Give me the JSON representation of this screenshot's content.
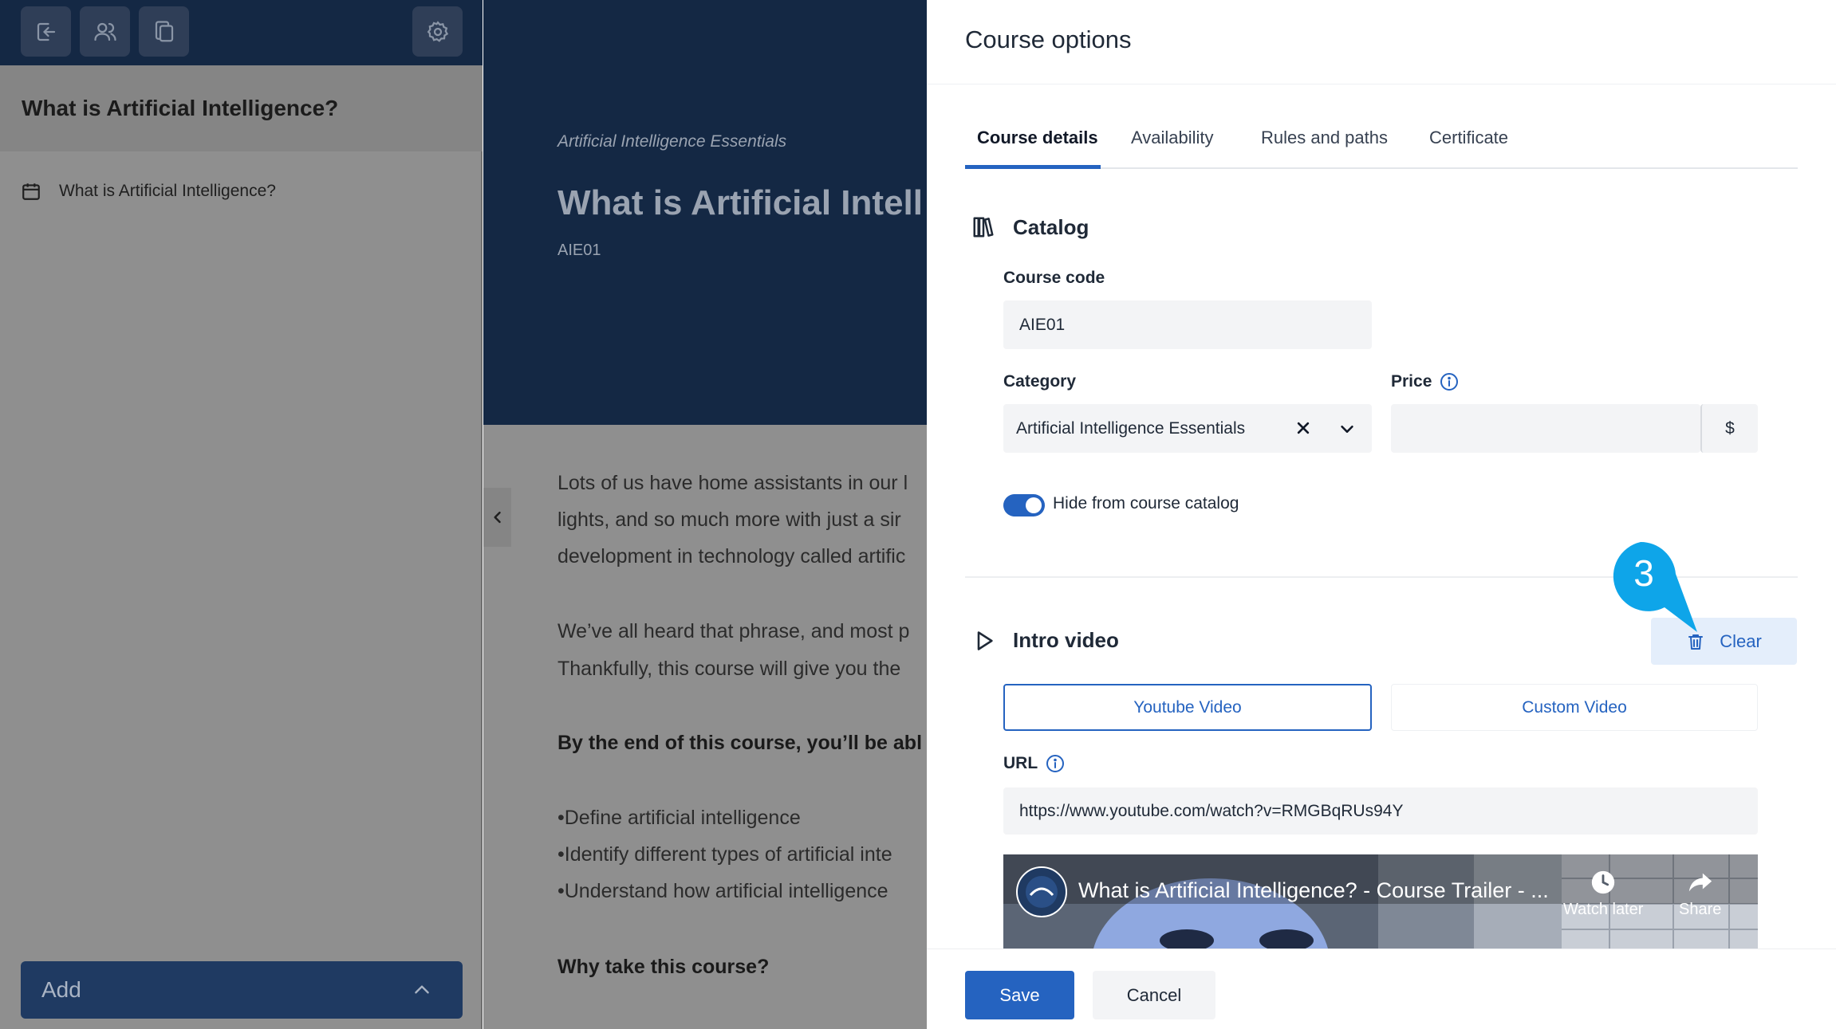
{
  "sidebar": {
    "toolbar": {
      "exit_icon": "exit-icon",
      "users_icon": "users-icon",
      "copy_icon": "copy-icon",
      "settings_icon": "gear-icon"
    },
    "title": "What is Artificial Intelligence?",
    "units": [
      {
        "label": "What is Artificial Intelligence?",
        "icon": "calendar-icon"
      }
    ],
    "add_label": "Add"
  },
  "content": {
    "category": "Artificial Intelligence Essentials",
    "title": "What is Artificial Intell",
    "code": "AIE01",
    "paragraphs": [
      "Lots of us have home assistants in our l",
      "lights, and so much more with just a sir",
      "development in technology called artific",
      "We’ve all heard that phrase, and most p",
      "Thankfully, this course will give you the",
      "By the end of this course, you’ll be abl",
      "•Define artificial intelligence",
      "•Identify different types of artificial inte",
      "•Understand how artificial intelligence",
      "Why take this course?"
    ]
  },
  "panel": {
    "title": "Course options",
    "tabs": [
      {
        "label": "Course details",
        "active": true
      },
      {
        "label": "Availability",
        "active": false
      },
      {
        "label": "Rules and paths",
        "active": false
      },
      {
        "label": "Certificate",
        "active": false
      }
    ],
    "catalog": {
      "title": "Catalog",
      "course_code_label": "Course code",
      "course_code_value": "AIE01",
      "category_label": "Category",
      "category_value": "Artificial Intelligence Essentials",
      "price_label": "Price",
      "price_value": "",
      "currency": "$",
      "hide_toggle_label": "Hide from course catalog",
      "hide_toggle_on": true
    },
    "intro_video": {
      "title": "Intro video",
      "clear_label": "Clear",
      "callout_number": "3",
      "youtube_tab": "Youtube Video",
      "custom_tab": "Custom Video",
      "url_label": "URL",
      "url_value": "https://www.youtube.com/watch?v=RMGBqRUs94Y",
      "thumbnail": {
        "title": "What is Artificial Intelligence? - Course Trailer - ...",
        "watch_later": "Watch later",
        "share": "Share"
      }
    },
    "footer": {
      "save_label": "Save",
      "cancel_label": "Cancel"
    }
  },
  "colors": {
    "navy": "#142844",
    "accent": "#2563c0",
    "callout": "#0ea5e9",
    "overlay_gray": "#8f8f8f"
  }
}
